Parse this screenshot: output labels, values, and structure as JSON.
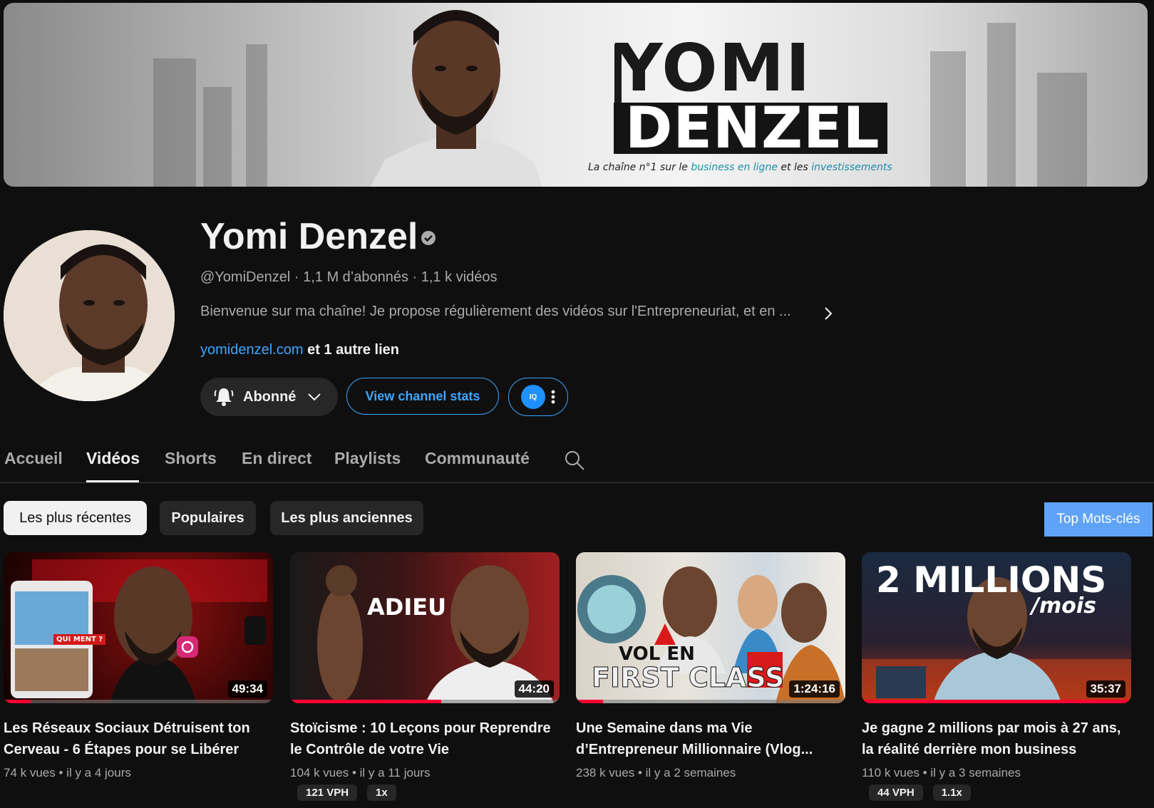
{
  "banner": {
    "logo_line1": "YOMI",
    "logo_line2": "DENZEL",
    "tagline_pre": "La chaîne n°1 sur le ",
    "tagline_hl1": "business en ligne",
    "tagline_mid": " et les ",
    "tagline_hl2": "investissements"
  },
  "channel": {
    "name": "Yomi Denzel",
    "handle": "@YomiDenzel",
    "subscribers": "1,1 M d’abonnés",
    "videos": "1,1 k vidéos",
    "description": "Bienvenue sur ma chaîne! Je propose régulièrement des vidéos sur l'Entrepreneuriat, et en ...",
    "link": "yomidenzel.com",
    "more_links": "et 1 autre lien",
    "separator": " · "
  },
  "buttons": {
    "subscribed": "Abonné",
    "stats": "View channel stats",
    "ext_icon": "IQ"
  },
  "tabs": [
    "Accueil",
    "Vidéos",
    "Shorts",
    "En direct",
    "Playlists",
    "Communauté"
  ],
  "active_tab": "Vidéos",
  "chips": [
    "Les plus récentes",
    "Populaires",
    "Les plus anciennes"
  ],
  "active_chip": "Les plus récentes",
  "keywords_button": "Top Mots-clés",
  "videos": [
    {
      "title": "Les Réseaux Sociaux Détruisent ton Cerveau - 6 Étapes pour se Libérer",
      "views": "74 k vues",
      "age": "il y a 4 jours",
      "duration": "49:34",
      "progress": 0.1,
      "thumb_text": "QUI MENT ?"
    },
    {
      "title": "Stoïcisme : 10 Leçons pour Reprendre le Contrôle de votre Vie",
      "views": "104 k vues",
      "age": "il y a 11 jours",
      "duration": "44:20",
      "progress": 0.56,
      "thumb_text": "ADIEU",
      "badges": [
        "121 VPH",
        "1x"
      ]
    },
    {
      "title": "Une Semaine dans ma Vie d’Entrepreneur Millionnaire (Vlog...",
      "views": "238 k vues",
      "age": "il y a 2 semaines",
      "duration": "1:24:16",
      "progress": 0.1,
      "thumb_text_1": "VOL EN",
      "thumb_text_2": "FIRST CLASS"
    },
    {
      "title": "Je gagne 2 millions par mois à 27 ans, la réalité derrière mon business",
      "views": "110 k vues",
      "age": "il y a 3 semaines",
      "duration": "35:37",
      "progress": 1.0,
      "thumb_text_1": "2 MILLIONS",
      "thumb_text_2": "/mois",
      "badges": [
        "44 VPH",
        "1.1x"
      ]
    }
  ],
  "meta_dot": " • ",
  "colors": {
    "background": "#0f0f0f",
    "link": "#3ea6ff",
    "progress": "#ff0033",
    "keywords_button": "#5ea3f5"
  }
}
